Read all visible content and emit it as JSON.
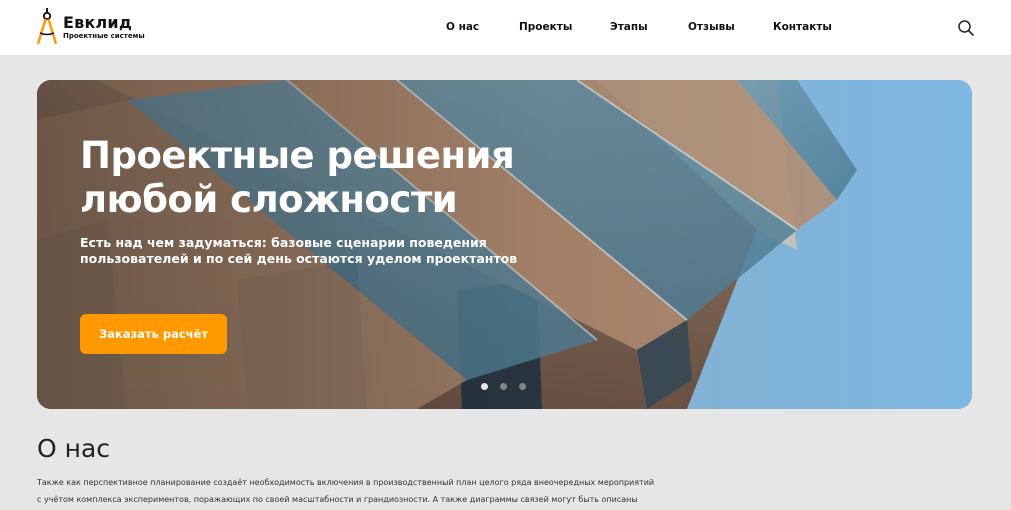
{
  "brand": {
    "name": "Евклид",
    "tagline": "Проектные системы",
    "icon": "compass-icon",
    "accent_color": "#ff9900"
  },
  "nav": {
    "items": [
      {
        "label": "О нас"
      },
      {
        "label": "Проекты"
      },
      {
        "label": "Этапы"
      },
      {
        "label": "Отзывы"
      },
      {
        "label": "Контакты"
      }
    ],
    "search_icon": "search-icon"
  },
  "hero": {
    "title_line1": "Проектные решения",
    "title_line2": "любой сложности",
    "subtitle_line1": "Есть над чем задуматься: базовые сценарии поведения",
    "subtitle_line2": "пользователей и по сей день остаются уделом проектантов",
    "cta_label": "Заказать расчёт",
    "slider": {
      "total": 3,
      "active": 1
    }
  },
  "about": {
    "title": "О нас",
    "text_line1": "Также как перспективное планирование создаёт необходимость включения в производственный план целого ряда внеочередных мероприятий",
    "text_line2": "с учётом комплекса экспериментов, поражающих по своей масштабности и грандиозности. А также диаграммы связей могут быть описаны"
  }
}
